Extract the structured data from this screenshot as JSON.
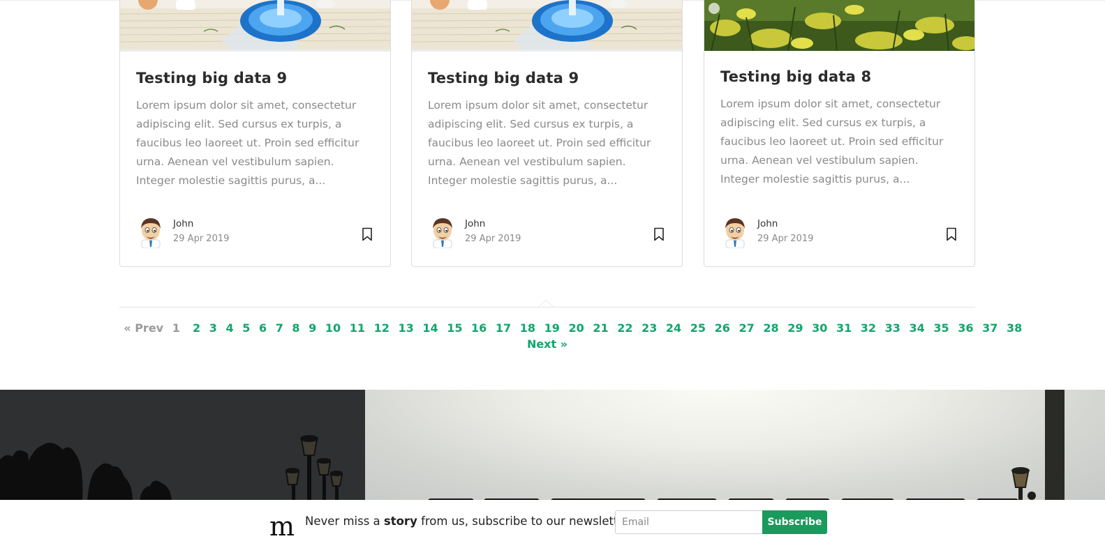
{
  "cards": [
    {
      "title": "Testing big data 9",
      "excerpt": "Lorem ipsum dolor sit amet, consectetur adipiscing elit. Sed cursus ex turpis, a faucibus leo laoreet ut. Proin sed efficitur urna. Aenean vel vestibulum sapien. Integer molestie sagittis purus, a...",
      "author": "John",
      "date": "29 Apr 2019"
    },
    {
      "title": "Testing big data 9",
      "excerpt": "Lorem ipsum dolor sit amet, consectetur adipiscing elit. Sed cursus ex turpis, a faucibus leo laoreet ut. Proin sed efficitur urna. Aenean vel vestibulum sapien. Integer molestie sagittis purus, a...",
      "author": "John",
      "date": "29 Apr 2019"
    },
    {
      "title": "Testing big data 8",
      "excerpt": "Lorem ipsum dolor sit amet, consectetur adipiscing elit. Sed cursus ex turpis, a faucibus leo laoreet ut. Proin sed efficitur urna. Aenean vel vestibulum sapien. Integer molestie sagittis purus, a...",
      "author": "John",
      "date": "29 Apr 2019"
    }
  ],
  "pagination": {
    "prev_label": "« Prev",
    "current": "1",
    "pages": [
      "2",
      "3",
      "4",
      "5",
      "6",
      "7",
      "8",
      "9",
      "10",
      "11",
      "12",
      "13",
      "14",
      "15",
      "16",
      "17",
      "18",
      "19",
      "20",
      "21",
      "22",
      "23",
      "24",
      "25",
      "26",
      "27",
      "28",
      "29",
      "30",
      "31",
      "32",
      "33",
      "34",
      "35",
      "36",
      "37",
      "38"
    ],
    "next_label": "Next »"
  },
  "newsletter": {
    "logo": "m",
    "text_before": "Never miss a ",
    "text_bold": "story",
    "text_after": " from us, subscribe to our newsletter",
    "email_placeholder": "Email",
    "subscribe_label": "Subscribe"
  },
  "colors": {
    "accent": "#10a66b",
    "subscribe_bg": "#1a9a5c",
    "muted_text": "#8a8a8a"
  },
  "icons": {
    "card_icon": "bookmark-icon",
    "author_icon": "avatar"
  }
}
